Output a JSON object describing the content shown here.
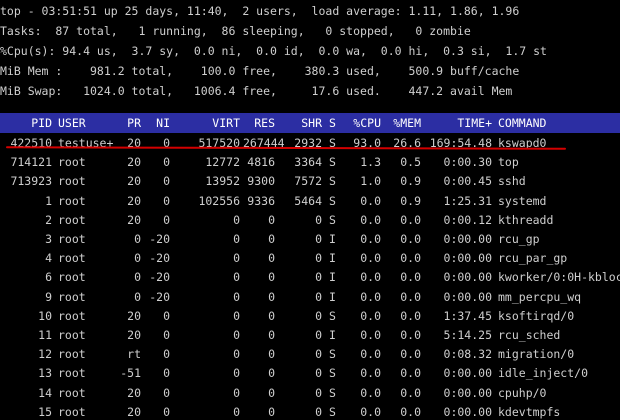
{
  "summary": [
    "top - 03:51:51 up 25 days, 11:40,  2 users,  load average: 1.11, 1.86, 1.96",
    "Tasks:  87 total,   1 running,  86 sleeping,   0 stopped,   0 zombie",
    "%Cpu(s): 94.4 us,  3.7 sy,  0.0 ni,  0.0 id,  0.0 wa,  0.0 hi,  0.3 si,  1.7 st",
    "MiB Mem :    981.2 total,    100.0 free,    380.3 used,    500.9 buff/cache",
    "MiB Swap:   1024.0 total,   1006.4 free,     17.6 used.    447.2 avail Mem"
  ],
  "colors": {
    "header_bg": "#2c2ea3",
    "text": "#cfcfcf",
    "highlight_underline": "#d40000"
  },
  "columns": {
    "pid": "PID",
    "user": "USER",
    "pr": "PR",
    "ni": "NI",
    "virt": "VIRT",
    "res": "RES",
    "shr": "SHR",
    "s": "S",
    "cpu": "%CPU",
    "mem": "%MEM",
    "time": "TIME+",
    "command": "COMMAND"
  },
  "processes": [
    {
      "pid": "422510",
      "user": "testuse+",
      "pr": "20",
      "ni": "0",
      "virt": "517520",
      "res": "267444",
      "shr": "2932",
      "s": "S",
      "cpu": "93.0",
      "mem": "26.6",
      "time": "169:54.48",
      "command": "kswapd0"
    },
    {
      "pid": "714121",
      "user": "root",
      "pr": "20",
      "ni": "0",
      "virt": "12772",
      "res": "4816",
      "shr": "3364",
      "s": "S",
      "cpu": "1.3",
      "mem": "0.5",
      "time": "0:00.30",
      "command": "top"
    },
    {
      "pid": "713923",
      "user": "root",
      "pr": "20",
      "ni": "0",
      "virt": "13952",
      "res": "9300",
      "shr": "7572",
      "s": "S",
      "cpu": "1.0",
      "mem": "0.9",
      "time": "0:00.45",
      "command": "sshd"
    },
    {
      "pid": "1",
      "user": "root",
      "pr": "20",
      "ni": "0",
      "virt": "102556",
      "res": "9336",
      "shr": "5464",
      "s": "S",
      "cpu": "0.0",
      "mem": "0.9",
      "time": "1:25.31",
      "command": "systemd"
    },
    {
      "pid": "2",
      "user": "root",
      "pr": "20",
      "ni": "0",
      "virt": "0",
      "res": "0",
      "shr": "0",
      "s": "S",
      "cpu": "0.0",
      "mem": "0.0",
      "time": "0:00.12",
      "command": "kthreadd"
    },
    {
      "pid": "3",
      "user": "root",
      "pr": "0",
      "ni": "-20",
      "virt": "0",
      "res": "0",
      "shr": "0",
      "s": "I",
      "cpu": "0.0",
      "mem": "0.0",
      "time": "0:00.00",
      "command": "rcu_gp"
    },
    {
      "pid": "4",
      "user": "root",
      "pr": "0",
      "ni": "-20",
      "virt": "0",
      "res": "0",
      "shr": "0",
      "s": "I",
      "cpu": "0.0",
      "mem": "0.0",
      "time": "0:00.00",
      "command": "rcu_par_gp"
    },
    {
      "pid": "6",
      "user": "root",
      "pr": "0",
      "ni": "-20",
      "virt": "0",
      "res": "0",
      "shr": "0",
      "s": "I",
      "cpu": "0.0",
      "mem": "0.0",
      "time": "0:00.00",
      "command": "kworker/0:0H-kbloc"
    },
    {
      "pid": "9",
      "user": "root",
      "pr": "0",
      "ni": "-20",
      "virt": "0",
      "res": "0",
      "shr": "0",
      "s": "I",
      "cpu": "0.0",
      "mem": "0.0",
      "time": "0:00.00",
      "command": "mm_percpu_wq"
    },
    {
      "pid": "10",
      "user": "root",
      "pr": "20",
      "ni": "0",
      "virt": "0",
      "res": "0",
      "shr": "0",
      "s": "S",
      "cpu": "0.0",
      "mem": "0.0",
      "time": "1:37.45",
      "command": "ksoftirqd/0"
    },
    {
      "pid": "11",
      "user": "root",
      "pr": "20",
      "ni": "0",
      "virt": "0",
      "res": "0",
      "shr": "0",
      "s": "I",
      "cpu": "0.0",
      "mem": "0.0",
      "time": "5:14.25",
      "command": "rcu_sched"
    },
    {
      "pid": "12",
      "user": "root",
      "pr": "rt",
      "ni": "0",
      "virt": "0",
      "res": "0",
      "shr": "0",
      "s": "S",
      "cpu": "0.0",
      "mem": "0.0",
      "time": "0:08.32",
      "command": "migration/0"
    },
    {
      "pid": "13",
      "user": "root",
      "pr": "-51",
      "ni": "0",
      "virt": "0",
      "res": "0",
      "shr": "0",
      "s": "S",
      "cpu": "0.0",
      "mem": "0.0",
      "time": "0:00.00",
      "command": "idle_inject/0"
    },
    {
      "pid": "14",
      "user": "root",
      "pr": "20",
      "ni": "0",
      "virt": "0",
      "res": "0",
      "shr": "0",
      "s": "S",
      "cpu": "0.0",
      "mem": "0.0",
      "time": "0:00.00",
      "command": "cpuhp/0"
    },
    {
      "pid": "15",
      "user": "root",
      "pr": "20",
      "ni": "0",
      "virt": "0",
      "res": "0",
      "shr": "0",
      "s": "S",
      "cpu": "0.0",
      "mem": "0.0",
      "time": "0:00.00",
      "command": "kdevtmpfs"
    }
  ]
}
